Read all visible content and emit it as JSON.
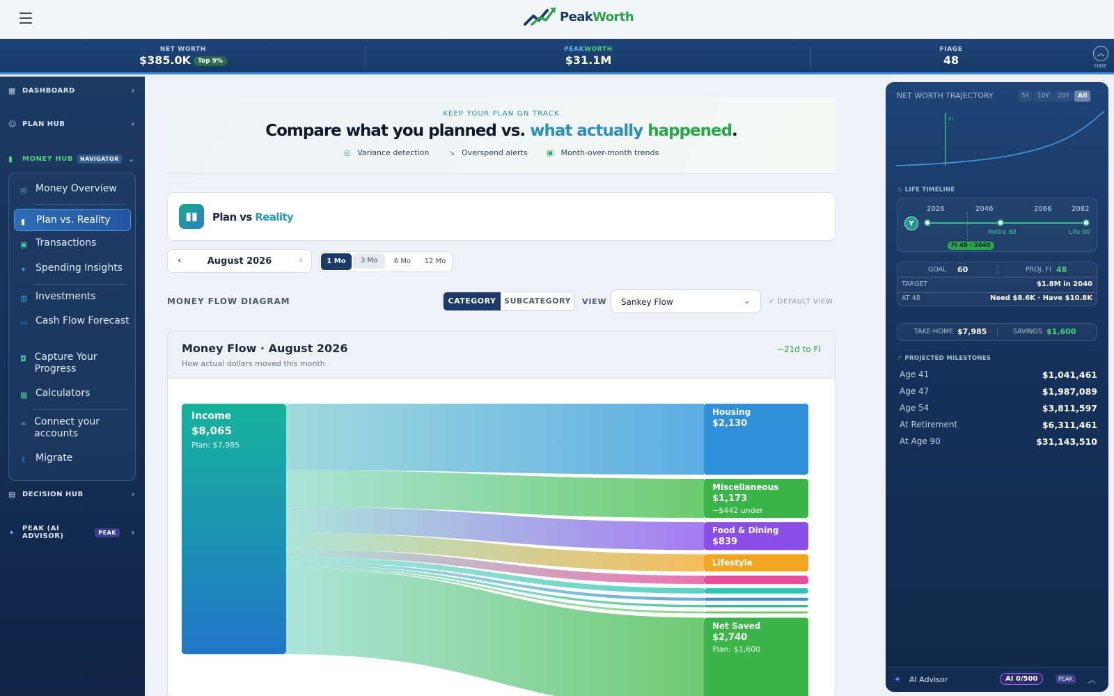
{
  "brand": {
    "name_a": "Peak",
    "name_b": "Worth"
  },
  "statbar": {
    "net_worth_label": "NET WORTH",
    "net_worth_value": "$385.0K",
    "net_worth_badge": "Top 9%",
    "peakworth_label_a": "PEAK",
    "peakworth_label_b": "WORTH",
    "peakworth_value": "$31.1M",
    "fiage_label": "FIAGE",
    "fiage_value": "48",
    "hide_label": "HIDE"
  },
  "sidebar": {
    "dashboard": "DASHBOARD",
    "plan_hub": "PLAN HUB",
    "money_hub": "MONEY HUB",
    "money_hub_badge": "NAVIGATOR",
    "items": [
      "Money Overview",
      "Plan vs. Reality",
      "Transactions",
      "Spending Insights",
      "Investments",
      "Cash Flow Forecast",
      "Capture Your Progress",
      "Calculators",
      "Connect your accounts",
      "Migrate"
    ],
    "decision_hub": "DECISION HUB",
    "peak_ai": "PEAK (AI ADVISOR)",
    "peak_badge": "PEAK"
  },
  "hero": {
    "eyebrow": "KEEP YOUR PLAN ON TRACK",
    "title_a": "Compare what you planned vs. ",
    "title_b": "what actually ",
    "title_c": "happened",
    "title_d": ".",
    "feature_1": "Variance detection",
    "feature_2": "Overspend alerts",
    "feature_3": "Month-over-month trends"
  },
  "pvr": {
    "title_a": "Plan vs ",
    "title_b": "Reality"
  },
  "controls": {
    "month": "August 2026",
    "ranges": [
      "1 Mo",
      "3 Mo",
      "6 Mo",
      "12 Mo"
    ],
    "selected_range": "1 Mo",
    "diagram_label": "MONEY FLOW DIAGRAM",
    "seg_category": "CATEGORY",
    "seg_subcategory": "SUBCATEGORY",
    "view_label": "VIEW",
    "view_value": "Sankey Flow",
    "default_view": "DEFAULT VIEW"
  },
  "flow": {
    "title": "Money Flow · August 2026",
    "subtitle": "How actual dollars moved this month",
    "fi_delta": "−21d to FI",
    "income": {
      "label": "Income",
      "amount": "$8,065",
      "plan": "Plan: $7,985"
    },
    "targets": [
      {
        "label": "Housing",
        "amount": "$2,130",
        "note": "",
        "value": 2130,
        "color_a": "#2f8fd8",
        "color_b": "#4aa3e0"
      },
      {
        "label": "Miscellaneous",
        "amount": "$1,173",
        "note": "−$442 under",
        "value": 1173,
        "color_a": "#3bb54a",
        "color_b": "#5cc55e"
      },
      {
        "label": "Food & Dining",
        "amount": "$839",
        "note": "",
        "value": 839,
        "color_a": "#8a4fe8",
        "color_b": "#9b6cf0"
      },
      {
        "label": "Lifestyle",
        "amount": "",
        "note": "",
        "value": 520,
        "color_a": "#f2a521",
        "color_b": "#f3b648"
      },
      {
        "label": "",
        "amount": "",
        "note": "",
        "value": 250,
        "color_a": "#e84d9a",
        "color_b": "#ea62a6"
      },
      {
        "label": "",
        "amount": "",
        "note": "",
        "value": 160,
        "color_a": "#2ec4b6",
        "color_b": "#45cdbf"
      },
      {
        "label": "",
        "amount": "",
        "note": "",
        "value": 90,
        "color_a": "#3f8fd0",
        "color_b": "#55a0da"
      },
      {
        "label": "",
        "amount": "",
        "note": "",
        "value": 70,
        "color_a": "#31b78b",
        "color_b": "#45c197"
      },
      {
        "label": "",
        "amount": "",
        "note": "",
        "value": 50,
        "color_a": "#6fc46a",
        "color_b": "#82cc7c"
      },
      {
        "label": "Net Saved",
        "amount": "$2,740",
        "note": "Plan: $1,600",
        "value": 2740,
        "color_a": "#3bb54a",
        "color_b": "#5fc462"
      }
    ]
  },
  "rpanel": {
    "trajectory_title": "NET WORTH TRAJECTORY",
    "tabs": [
      "5Y",
      "10Y",
      "20Y",
      "All"
    ],
    "active_tab": "All",
    "fi_marker": "FI",
    "timeline_title": "LIFE TIMELINE",
    "years": [
      "2026",
      "2046",
      "2066",
      "2082"
    ],
    "you": "Y",
    "retire_label": "Retire 60",
    "life_label": "Life 90",
    "fi_tag": "FI 48 · 2040",
    "goal_label": "GOAL",
    "goal_value": "60",
    "projfi_label": "PROJ. FI",
    "projfi_value": "48",
    "target_label": "TARGET",
    "target_value": "$1.8M in 2040",
    "at48_label": "AT 48",
    "at48_value": "Need $8.6K · Have $10.8K",
    "takehome_label": "TAKE-HOME",
    "takehome_value": "$7,985",
    "savings_label": "SAVINGS",
    "savings_value": "$1,600",
    "milestones_title": "PROJECTED MILESTONES",
    "milestones": [
      {
        "label": "Age 41",
        "value": "$1,041,461"
      },
      {
        "label": "Age 47",
        "value": "$1,987,089"
      },
      {
        "label": "Age 54",
        "value": "$3,811,597"
      },
      {
        "label": "At Retirement",
        "value": "$6,311,461"
      },
      {
        "label": "At Age 90",
        "value": "$31,143,510"
      }
    ],
    "ai_label": "AI Advisor",
    "ai_count": "AI 0/500",
    "ai_peak": "PEAK"
  },
  "colors": {
    "accent_navy": "#1b3a68",
    "brand_green": "#2aa54a",
    "brand_blue": "#2c8fb9"
  }
}
